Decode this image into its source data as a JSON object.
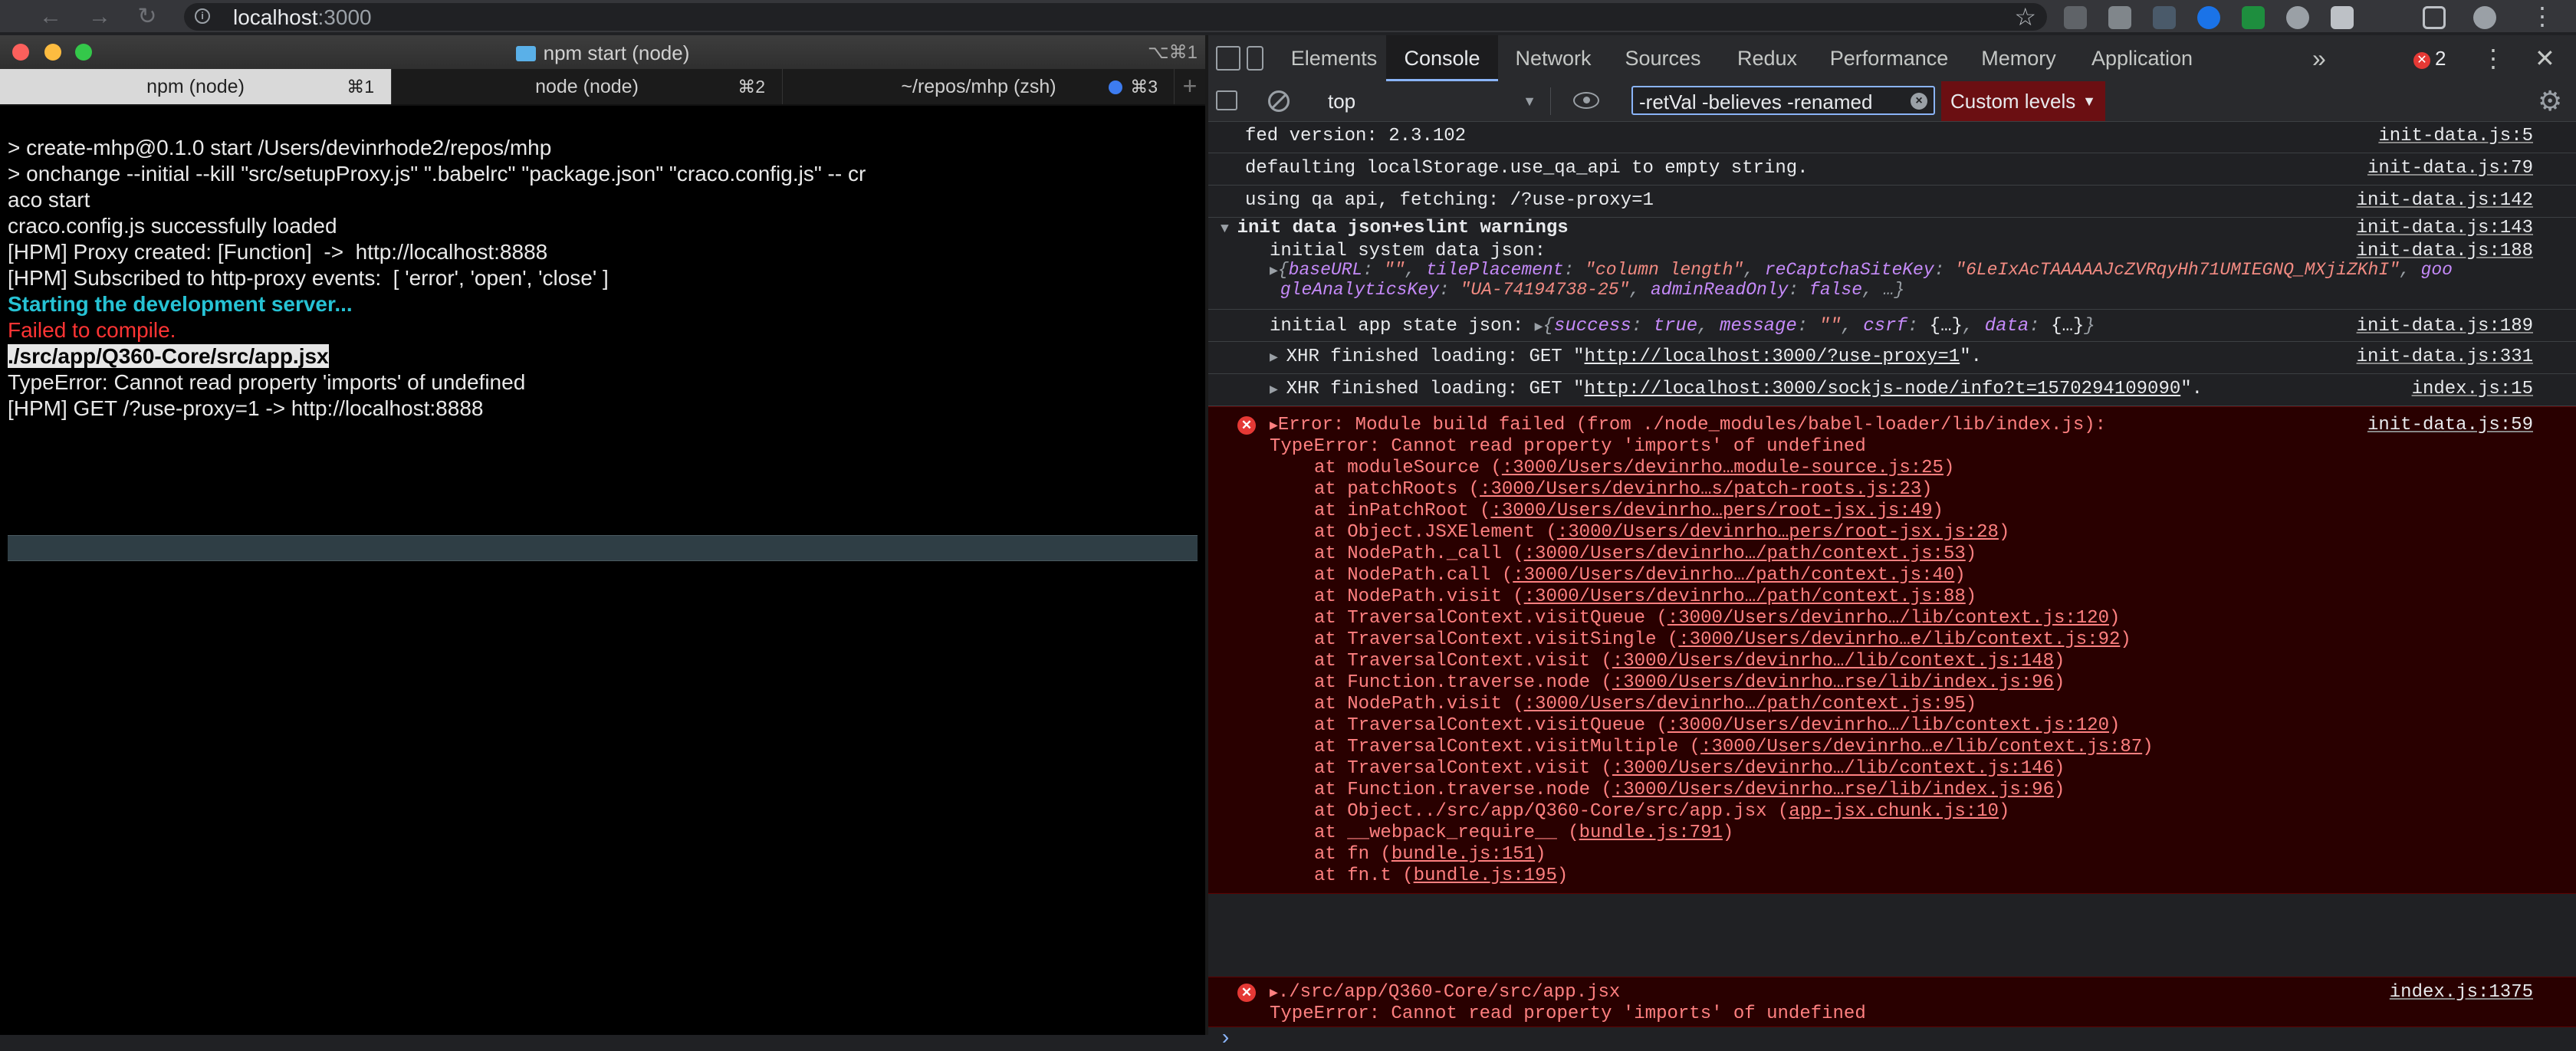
{
  "browser": {
    "url_host": "localhost",
    "url_port": ":3000"
  },
  "terminal": {
    "title": "npm start (node)",
    "shortcut": "⌥⌘1",
    "tabs": [
      {
        "label": "npm (node)",
        "shortcut": "⌘1"
      },
      {
        "label": "node (node)",
        "shortcut": "⌘2"
      },
      {
        "label": "~/repos/mhp (zsh)",
        "shortcut": "⌘3"
      }
    ],
    "lines": [
      "> create-mhp@0.1.0 start /Users/devinrhode2/repos/mhp",
      "> onchange --initial --kill \"src/setupProxy.js\" \".babelrc\" \"package.json\" \"craco.config.js\" -- cr",
      "aco start",
      "",
      "craco.config.js successfully loaded",
      "[HPM] Proxy created: [Function]  ->  http://localhost:8888",
      "[HPM] Subscribed to http-proxy events:  [ 'error', 'open', 'close' ]",
      "Starting the development server...",
      "",
      "Failed to compile.",
      "",
      "./src/app/Q360-Core/src/app.jsx",
      "TypeError: Cannot read property 'imports' of undefined",
      "[HPM] GET /?use-proxy=1 -> http://localhost:8888"
    ]
  },
  "devtools": {
    "tabs": [
      "Elements",
      "Console",
      "Network",
      "Sources",
      "Redux",
      "Performance",
      "Memory",
      "Application"
    ],
    "more_tabs": "»",
    "error_count": "2",
    "context": "top",
    "filter_value": "-retVal -believes -renamed",
    "levels": "Custom levels"
  },
  "console": {
    "m1": {
      "text": "fed version: 2.3.102",
      "src": "init-data.js:5"
    },
    "m2": {
      "text": "defaulting localStorage.use_qa_api to empty string.",
      "src": "init-data.js:79"
    },
    "m3": {
      "text": "using qa api, fetching: /?use-proxy=1",
      "src": "init-data.js:142"
    },
    "g1": {
      "text": "init data json+eslint warnings",
      "src": "init-data.js:143"
    },
    "sys": {
      "label": "initial system data json:",
      "src": "init-data.js:188",
      "k1": "baseURL",
      "v1": "\"\"",
      "k2": "tilePlacement",
      "v2": "\"column length\"",
      "k3": "reCaptchaSiteKey",
      "v3": "\"6LeIxAcTAAAAAJcZVRqyHh71UMIEGNQ_MXjiZKhI\"",
      "k4a": "goo",
      "k4b": "gleAnalyticsKey",
      "v4": "\"UA-74194738-25\"",
      "k5": "adminReadOnly",
      "v5": "false",
      "tail": "…}"
    },
    "app": {
      "label": "initial app state json:",
      "src": "init-data.js:189",
      "k1": "success",
      "v1": "true",
      "k2": "message",
      "v2": "\"\"",
      "k3": "csrf",
      "v3": "{…}",
      "k4": "data",
      "v4": "{…}"
    },
    "xhr1": {
      "prefix": "XHR finished loading: GET \"",
      "url": "http://localhost:3000/?use-proxy=1",
      "suffix": "\".",
      "src": "init-data.js:331"
    },
    "xhr2": {
      "prefix": "XHR finished loading: GET \"",
      "url": "http://localhost:3000/sockjs-node/info?t=1570294109090",
      "suffix": "\".",
      "src": "index.js:15"
    },
    "err1": {
      "head": "Error: Module build failed (from ./node_modules/babel-loader/lib/index.js):",
      "type": "TypeError: Cannot read property 'imports' of undefined",
      "src": "init-data.js:59",
      "stack": [
        {
          "fn": "moduleSource",
          "loc": ":3000/Users/devinrho…module-source.js:25"
        },
        {
          "fn": "patchRoots",
          "loc": ":3000/Users/devinrho…s/patch-roots.js:23"
        },
        {
          "fn": "inPatchRoot",
          "loc": ":3000/Users/devinrho…pers/root-jsx.js:49"
        },
        {
          "fn": "Object.JSXElement",
          "loc": ":3000/Users/devinrho…pers/root-jsx.js:28"
        },
        {
          "fn": "NodePath._call",
          "loc": ":3000/Users/devinrho…/path/context.js:53"
        },
        {
          "fn": "NodePath.call",
          "loc": ":3000/Users/devinrho…/path/context.js:40"
        },
        {
          "fn": "NodePath.visit",
          "loc": ":3000/Users/devinrho…/path/context.js:88"
        },
        {
          "fn": "TraversalContext.visitQueue",
          "loc": ":3000/Users/devinrho…/lib/context.js:120"
        },
        {
          "fn": "TraversalContext.visitSingle",
          "loc": ":3000/Users/devinrho…e/lib/context.js:92"
        },
        {
          "fn": "TraversalContext.visit",
          "loc": ":3000/Users/devinrho…/lib/context.js:148"
        },
        {
          "fn": "Function.traverse.node",
          "loc": ":3000/Users/devinrho…rse/lib/index.js:96"
        },
        {
          "fn": "NodePath.visit",
          "loc": ":3000/Users/devinrho…/path/context.js:95"
        },
        {
          "fn": "TraversalContext.visitQueue",
          "loc": ":3000/Users/devinrho…/lib/context.js:120"
        },
        {
          "fn": "TraversalContext.visitMultiple",
          "loc": ":3000/Users/devinrho…e/lib/context.js:87"
        },
        {
          "fn": "TraversalContext.visit",
          "loc": ":3000/Users/devinrho…/lib/context.js:146"
        },
        {
          "fn": "Function.traverse.node",
          "loc": ":3000/Users/devinrho…rse/lib/index.js:96"
        },
        {
          "fn": "Object../src/app/Q360-Core/src/app.jsx",
          "loc": "app-jsx.chunk.js:10"
        },
        {
          "fn": "__webpack_require__",
          "loc": "bundle.js:791"
        },
        {
          "fn": "fn",
          "loc": "bundle.js:151"
        },
        {
          "fn": "fn.t",
          "loc": "bundle.js:195"
        }
      ]
    },
    "err2": {
      "head": "./src/app/Q360-Core/src/app.jsx",
      "type": "TypeError: Cannot read property 'imports' of undefined",
      "src": "index.js:1375"
    },
    "prompt": "›"
  },
  "colors": {
    "error_bg": "#290000",
    "error_text": "#ff8080",
    "terminal_cyan": "#26c2d4",
    "terminal_red": "#ff3434",
    "levels_bg": "#6b0f12"
  }
}
